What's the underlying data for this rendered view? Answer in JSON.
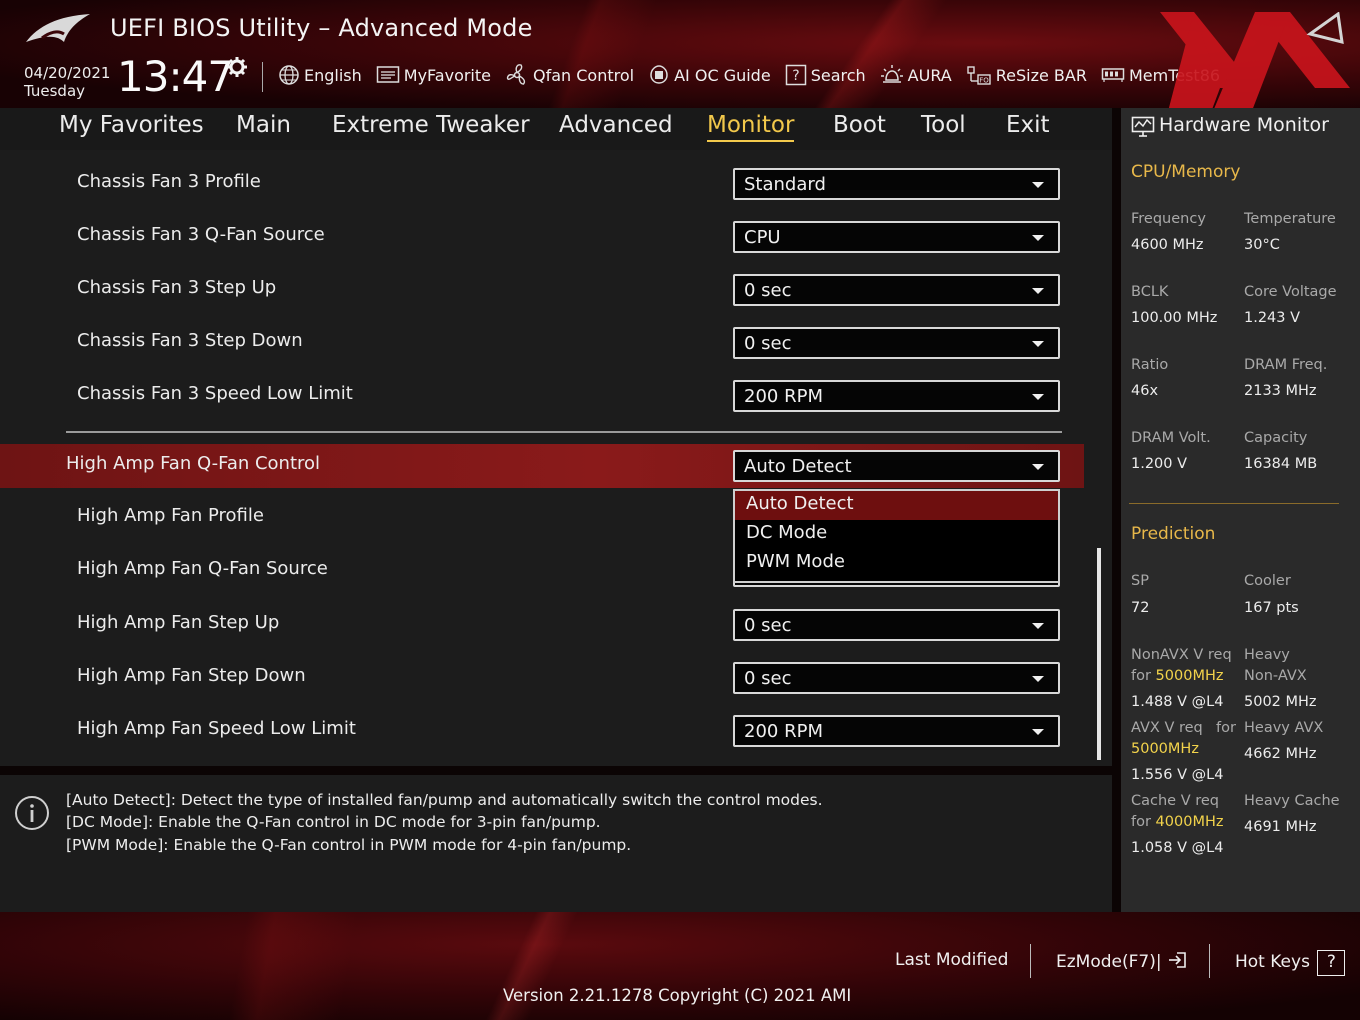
{
  "header": {
    "title": "UEFI BIOS Utility – Advanced Mode",
    "date": "04/20/2021",
    "day": "Tuesday",
    "time": "13:47",
    "tools": [
      {
        "label": "English",
        "icon": "globe-icon"
      },
      {
        "label": "MyFavorite",
        "icon": "favorite-list-icon"
      },
      {
        "label": "Qfan Control",
        "icon": "fan-icon"
      },
      {
        "label": "AI OC Guide",
        "icon": "ai-chip-icon"
      },
      {
        "label": "Search",
        "icon": "question-box-icon"
      },
      {
        "label": "AURA",
        "icon": "aura-light-icon"
      },
      {
        "label": "ReSize BAR",
        "icon": "resize-bar-icon"
      },
      {
        "label": "MemTest86",
        "icon": "memory-icon"
      }
    ]
  },
  "menu": {
    "tabs": [
      "My Favorites",
      "Main",
      "Extreme Tweaker",
      "Advanced",
      "Monitor",
      "Boot",
      "Tool",
      "Exit"
    ],
    "active": "Monitor"
  },
  "settings": {
    "chassis_rows": [
      {
        "label": "Chassis Fan 3 Profile",
        "value": "Standard"
      },
      {
        "label": "Chassis Fan 3 Q-Fan Source",
        "value": "CPU"
      },
      {
        "label": "Chassis Fan 3 Step Up",
        "value": "0 sec"
      },
      {
        "label": "Chassis Fan 3 Step Down",
        "value": "0 sec"
      },
      {
        "label": "Chassis Fan 3 Speed Low Limit",
        "value": "200 RPM"
      }
    ],
    "selected_row": {
      "label": "High Amp Fan Q-Fan Control",
      "value": "Auto Detect"
    },
    "popup_options": [
      "Auto Detect",
      "DC Mode",
      "PWM Mode"
    ],
    "popup_selected": "Auto Detect",
    "highamp_rows": [
      {
        "label": "High Amp Fan Profile",
        "value": ""
      },
      {
        "label": "High Amp Fan Q-Fan Source",
        "value": ""
      },
      {
        "label": "High Amp Fan Step Up",
        "value": "0 sec"
      },
      {
        "label": "High Amp Fan Step Down",
        "value": "0 sec"
      },
      {
        "label": "High Amp Fan Speed Low Limit",
        "value": "200 RPM"
      }
    ]
  },
  "help": {
    "lines": [
      "[Auto Detect]: Detect the type of installed fan/pump and automatically switch the control modes.",
      "[DC Mode]: Enable the Q-Fan control in DC mode for 3-pin fan/pump.",
      "[PWM Mode]: Enable the Q-Fan control in PWM mode for 4-pin fan/pump."
    ]
  },
  "hw_monitor": {
    "title": "Hardware Monitor",
    "cpu_section": "CPU/Memory",
    "cpu": [
      {
        "label": "Frequency",
        "value": "4600 MHz"
      },
      {
        "label": "Temperature",
        "value": "30°C"
      },
      {
        "label": "BCLK",
        "value": "100.00 MHz"
      },
      {
        "label": "Core Voltage",
        "value": "1.243 V"
      },
      {
        "label": "Ratio",
        "value": "46x"
      },
      {
        "label": "DRAM Freq.",
        "value": "2133 MHz"
      },
      {
        "label": "DRAM Volt.",
        "value": "1.200 V"
      },
      {
        "label": "Capacity",
        "value": "16384 MB"
      }
    ],
    "prediction_section": "Prediction",
    "sp_label": "SP",
    "sp_value": "72",
    "cooler_label": "Cooler",
    "cooler_value": "167 pts",
    "nonavx_label": "NonAVX V req",
    "for_word": "for",
    "nonavx_freq": "5000MHz",
    "nonavx_value": "1.488 V @L4",
    "heavy_label": "Heavy",
    "heavy_nonavx_label": "Non-AVX",
    "heavy_nonavx_value": "5002 MHz",
    "avx_label": "AVX V req",
    "avx_freq": "5000MHz",
    "avx_value": "1.556 V @L4",
    "heavy_avx_label": "Heavy AVX",
    "heavy_avx_value": "4662 MHz",
    "cache_label": "Cache V req",
    "cache_freq": "4000MHz",
    "cache_value": "1.058 V @L4",
    "heavy_cache_label": "Heavy Cache",
    "heavy_cache_value": "4691 MHz"
  },
  "footer": {
    "last_modified": "Last Modified",
    "ezmode": "EzMode(F7)|",
    "hotkeys": "Hot Keys",
    "hotkeys_glyph": "?",
    "version": "Version 2.21.1278 Copyright (C) 2021 AMI"
  },
  "colors": {
    "accent": "#f2c84b",
    "selection_red": "#8a1a1a",
    "monitor_bg": "#2a2a2a"
  }
}
